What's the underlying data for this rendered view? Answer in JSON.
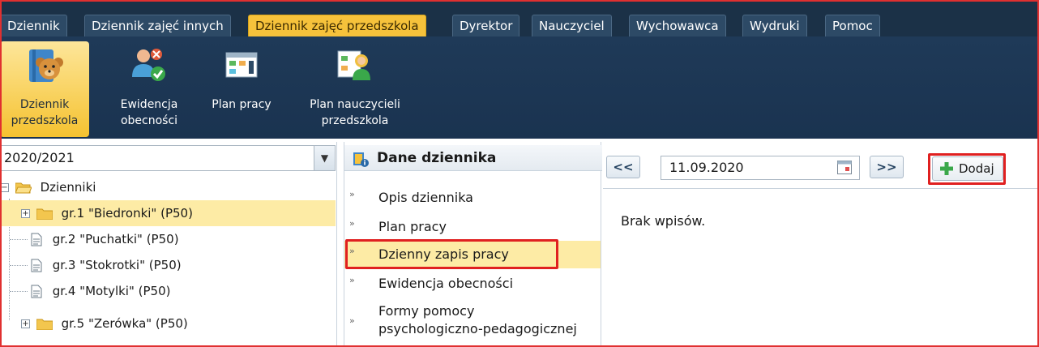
{
  "tabs": [
    {
      "label": "Dziennik",
      "active": false
    },
    {
      "label": "Dziennik zajęć innych",
      "active": false
    },
    {
      "label": "Dziennik zajęć przedszkola",
      "active": true
    },
    {
      "label": "Dyrektor",
      "active": false
    },
    {
      "label": "Nauczyciel",
      "active": false
    },
    {
      "label": "Wychowawca",
      "active": false
    },
    {
      "label": "Wydruki",
      "active": false
    },
    {
      "label": "Pomoc",
      "active": false
    }
  ],
  "ribbon": [
    {
      "line1": "Dziennik",
      "line2": "przedszkola",
      "icon": "teddy-bear-book-icon",
      "active": true
    },
    {
      "line1": "Ewidencja",
      "line2": "obecności",
      "icon": "attendance-people-icon",
      "active": false
    },
    {
      "line1": "Plan pracy",
      "line2": "",
      "icon": "work-plan-icon",
      "active": false
    },
    {
      "line1": "Plan nauczycieli",
      "line2": "przedszkola",
      "icon": "teacher-plan-icon",
      "active": false
    }
  ],
  "tree": {
    "year": "2020/2021",
    "root": "Dzienniki",
    "groups": [
      {
        "label": "gr.1 \"Biedronki\" (P50)",
        "type": "folder",
        "selected": true
      },
      {
        "label": "gr.2 \"Puchatki\" (P50)",
        "type": "doc",
        "selected": false
      },
      {
        "label": "gr.3 \"Stokrotki\" (P50)",
        "type": "doc",
        "selected": false
      },
      {
        "label": "gr.4 \"Motylki\" (P50)",
        "type": "doc",
        "selected": false
      },
      {
        "label": "gr.5 \"Zerówka\" (P50)",
        "type": "folder",
        "selected": false
      }
    ]
  },
  "menu": {
    "header": "Dane dziennika",
    "items": [
      {
        "line1": "Opis dziennika",
        "line2": "",
        "selected": false
      },
      {
        "line1": "Plan pracy",
        "line2": "",
        "selected": false
      },
      {
        "line1": "Dzienny zapis pracy",
        "line2": "",
        "selected": true
      },
      {
        "line1": "Ewidencja obecności",
        "line2": "",
        "selected": false
      },
      {
        "line1": "Formy pomocy",
        "line2": "psychologiczno-pedagogicznej",
        "selected": false
      }
    ]
  },
  "content": {
    "prev_label": "<<",
    "next_label": ">>",
    "date": "11.09.2020",
    "add_label": "Dodaj",
    "empty_message": "Brak wpisów."
  },
  "colors": {
    "active_tab": "#f6c23b",
    "ribbon_bg": "#1f3a58",
    "selection": "#fdeba5",
    "highlight_outline": "#e02020"
  }
}
